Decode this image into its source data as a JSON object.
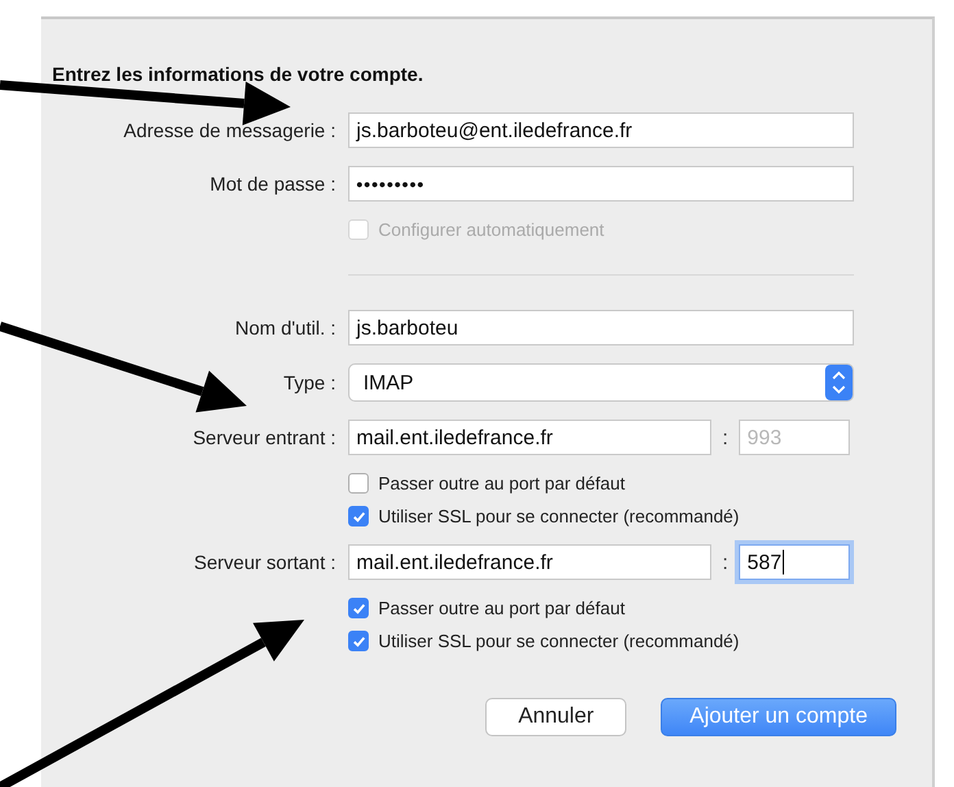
{
  "heading": "Entrez les informations de votre compte.",
  "credentials": [
    {
      "label": "Adresse de messagerie :",
      "value": "js.barboteu@ent.iledefrance.fr",
      "kind": "text"
    },
    {
      "label": "Mot de passe :",
      "value": "•••••••••",
      "kind": "password"
    }
  ],
  "auto_config": {
    "label": "Configurer automatiquement",
    "checked": false,
    "disabled": true
  },
  "account": [
    {
      "label": "Nom d'util. :",
      "value": "js.barboteu",
      "kind": "text"
    },
    {
      "label": "Type :",
      "value": "IMAP",
      "kind": "popup"
    }
  ],
  "servers": [
    {
      "label": "Serveur entrant :",
      "host": "mail.ent.iledefrance.fr",
      "separator": ":",
      "port": "993",
      "port_disabled": true,
      "port_focused": false,
      "options": [
        {
          "label": "Passer outre au port par défaut",
          "checked": false
        },
        {
          "label": "Utiliser SSL pour se connecter (recommandé)",
          "checked": true
        }
      ]
    },
    {
      "label": "Serveur sortant :",
      "host": "mail.ent.iledefrance.fr",
      "separator": ":",
      "port": "587",
      "port_disabled": false,
      "port_focused": true,
      "options": [
        {
          "label": "Passer outre au port par défaut",
          "checked": true
        },
        {
          "label": "Utiliser SSL pour se connecter (recommandé)",
          "checked": true
        }
      ]
    }
  ],
  "buttons": [
    {
      "label": "Annuler",
      "kind": "default"
    },
    {
      "label": "Ajouter un compte",
      "kind": "primary"
    }
  ]
}
